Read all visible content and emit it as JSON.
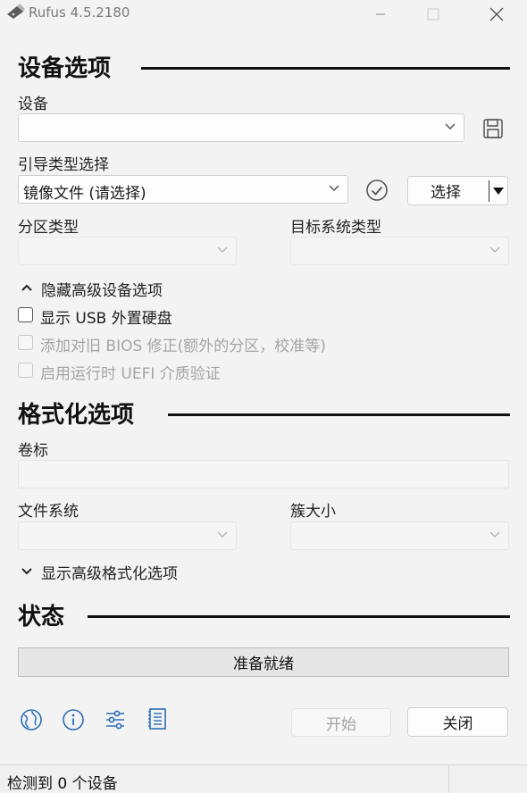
{
  "window": {
    "title": "Rufus 4.5.2180"
  },
  "device_section": {
    "title": "设备选项",
    "device_label": "设备",
    "device_value": "",
    "boot_label": "引导类型选择",
    "boot_value": "镜像文件 (请选择)",
    "select_button": "选择",
    "partition_label": "分区类型",
    "target_label": "目标系统类型",
    "advanced_toggle": "隐藏高级设备选项",
    "options": [
      {
        "label": "显示 USB 外置硬盘",
        "checked": false,
        "enabled": true
      },
      {
        "label": "添加对旧 BIOS 修正(额外的分区，校准等)",
        "checked": false,
        "enabled": false
      },
      {
        "label": "启用运行时 UEFI 介质验证",
        "checked": false,
        "enabled": false
      }
    ]
  },
  "format_section": {
    "title": "格式化选项",
    "volume_label": "卷标",
    "filesystem_label": "文件系统",
    "cluster_label": "簇大小",
    "advanced_toggle": "显示高级格式化选项"
  },
  "status_section": {
    "title": "状态",
    "progress_text": "准备就绪"
  },
  "actions": {
    "start_label": "开始",
    "close_label": "关闭"
  },
  "statusbar": {
    "text": "检测到 0 个设备"
  },
  "icons": {
    "save": "save-icon",
    "check": "check-circle-icon",
    "language": "globe-icon",
    "about": "info-icon",
    "settings": "sliders-icon",
    "log": "log-icon"
  },
  "colors": {
    "background": "#f3f3f3",
    "accent_blue": "#2a6db8",
    "header_text": "#111111"
  }
}
